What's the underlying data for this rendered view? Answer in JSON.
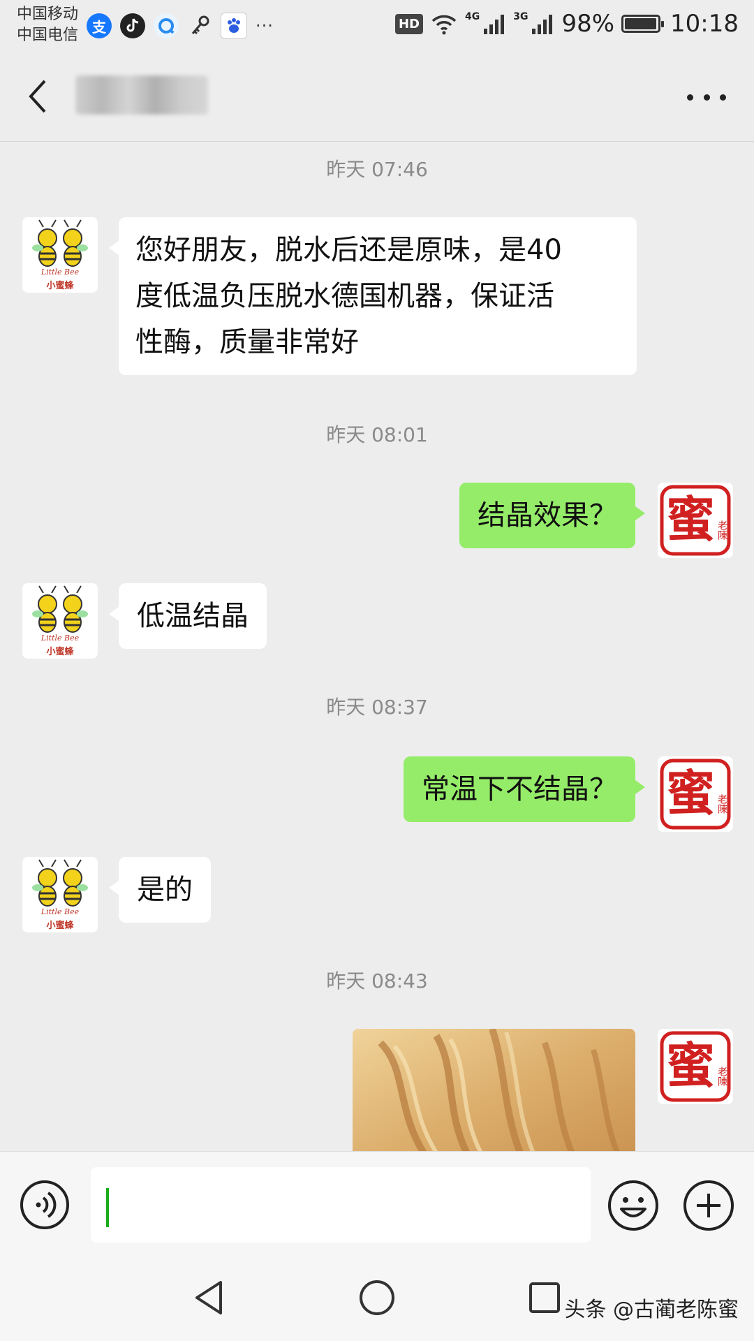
{
  "status_bar": {
    "carrier_1": "中国移动",
    "carrier_2": "中国电信",
    "notification_icons": [
      "alipay-icon",
      "douyin-icon",
      "browser-icon",
      "key-icon",
      "baidu-icon"
    ],
    "more": "···",
    "hd": "HD",
    "net_1": "4G",
    "net_2": "3G",
    "battery": "98%",
    "battery_level": 0.98,
    "time": "10:18"
  },
  "header": {
    "contact_name": "████████",
    "contact_name_blurred": true
  },
  "messages": [
    {
      "type": "timestamp",
      "text": "昨天 07:46"
    },
    {
      "type": "text",
      "side": "in",
      "lines": [
        "您好朋友，脱水后还是原味，是40",
        "度低温负压脱水德国机器，保证活",
        "性酶，质量非常好"
      ]
    },
    {
      "type": "timestamp",
      "text": "昨天 08:01"
    },
    {
      "type": "text",
      "side": "out",
      "text": "结晶效果？"
    },
    {
      "type": "text",
      "side": "in",
      "text": "低温结晶"
    },
    {
      "type": "timestamp",
      "text": "昨天 08:37"
    },
    {
      "type": "text",
      "side": "out",
      "text": "常温下不结晶？"
    },
    {
      "type": "text",
      "side": "in",
      "text": "是的"
    },
    {
      "type": "timestamp",
      "text": "昨天 08:43"
    },
    {
      "type": "image",
      "side": "out"
    }
  ],
  "avatars": {
    "incoming": {
      "line_1": "Little Bee",
      "line_2": "小蜜蜂"
    },
    "outgoing": {
      "seal_char": "蜜",
      "seal_sub": "老陳"
    }
  },
  "input_bar": {
    "text": ""
  },
  "colors": {
    "background": "#ededed",
    "outgoing_bubble": "#95ec69",
    "incoming_bubble": "#ffffff",
    "seal_red": "#d02020"
  },
  "watermark": "头条 @古蔺老陈蜜"
}
